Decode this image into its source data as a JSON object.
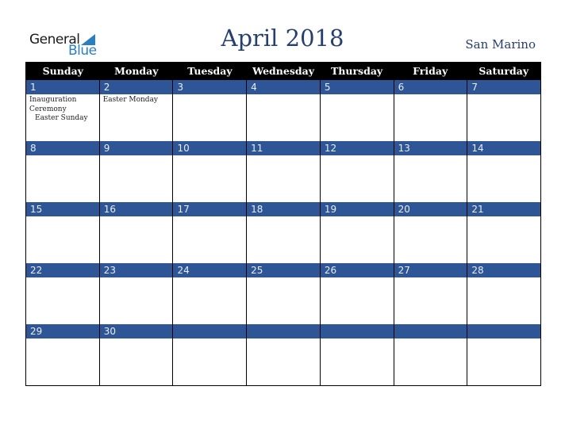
{
  "logo": {
    "line1": "General",
    "line2": "Blue"
  },
  "title": "April 2018",
  "country": "San Marino",
  "colors": {
    "header_bg": "#000000",
    "band_bg": "#2e5596",
    "title": "#26406e",
    "logo_blue": "#2a7fc1"
  },
  "weekdays": [
    "Sunday",
    "Monday",
    "Tuesday",
    "Wednesday",
    "Thursday",
    "Friday",
    "Saturday"
  ],
  "weeks": [
    {
      "days": [
        "1",
        "2",
        "3",
        "4",
        "5",
        "6",
        "7"
      ],
      "events": [
        [
          "Inauguration Ceremony",
          "Easter Sunday"
        ],
        [
          "Easter Monday"
        ],
        [],
        [],
        [],
        [],
        []
      ]
    },
    {
      "days": [
        "8",
        "9",
        "10",
        "11",
        "12",
        "13",
        "14"
      ],
      "events": [
        [],
        [],
        [],
        [],
        [],
        [],
        []
      ]
    },
    {
      "days": [
        "15",
        "16",
        "17",
        "18",
        "19",
        "20",
        "21"
      ],
      "events": [
        [],
        [],
        [],
        [],
        [],
        [],
        []
      ]
    },
    {
      "days": [
        "22",
        "23",
        "24",
        "25",
        "26",
        "27",
        "28"
      ],
      "events": [
        [],
        [],
        [],
        [],
        [],
        [],
        []
      ]
    },
    {
      "days": [
        "29",
        "30",
        "",
        "",
        "",
        "",
        ""
      ],
      "events": [
        [],
        [],
        [],
        [],
        [],
        [],
        []
      ]
    }
  ]
}
